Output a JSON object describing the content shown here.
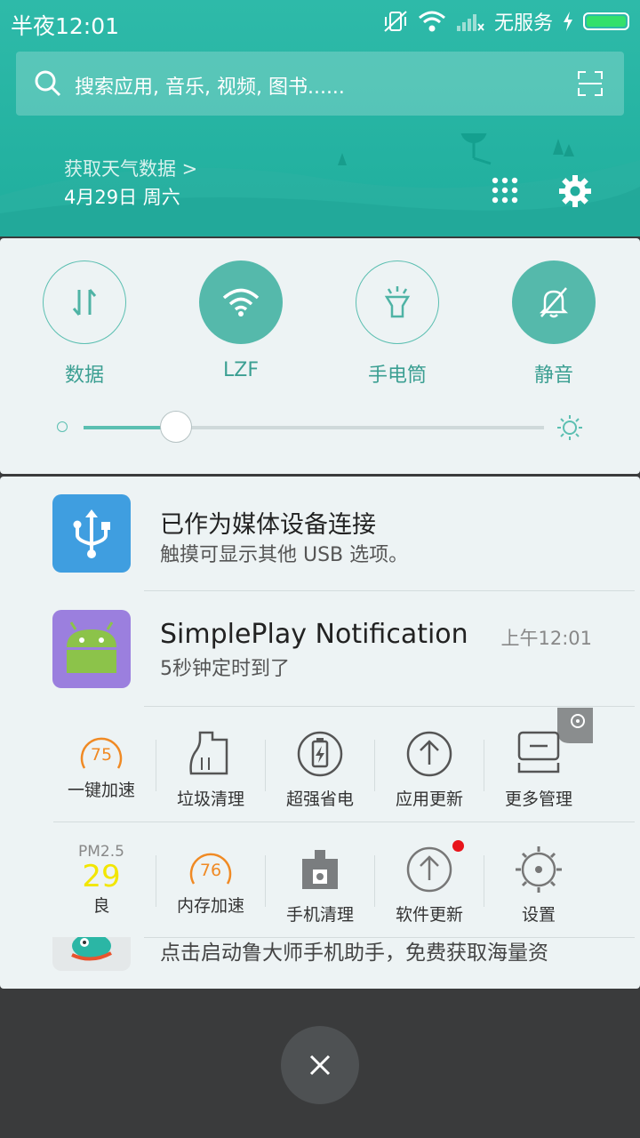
{
  "status_bar": {
    "time": "半夜12:01",
    "carrier": "无服务"
  },
  "search": {
    "placeholder": "搜索应用, 音乐, 视频, 图书......"
  },
  "weather": {
    "link": "获取天气数据 >",
    "date": "4月29日 周六"
  },
  "quick_settings": {
    "toggles": [
      {
        "label": "数据",
        "icon": "data-arrows-icon",
        "active": false
      },
      {
        "label": "LZF",
        "icon": "wifi-icon",
        "active": true
      },
      {
        "label": "手电筒",
        "icon": "flashlight-icon",
        "active": false
      },
      {
        "label": "静音",
        "icon": "bell-mute-icon",
        "active": true
      }
    ],
    "brightness": 0.2
  },
  "notifications": [
    {
      "title": "已作为媒体设备连接",
      "text": "触摸可显示其他 USB 选项。",
      "icon": "usb-icon",
      "color": "#3f9ee0"
    },
    {
      "title": "SimplePlay Notification",
      "text": "5秒钟定时到了",
      "time": "上午12:01",
      "icon": "android-icon",
      "color": "#9b7fde"
    }
  ],
  "toolbox": {
    "row1": [
      {
        "label": "一键加速",
        "value": "75"
      },
      {
        "label": "垃圾清理"
      },
      {
        "label": "超强省电"
      },
      {
        "label": "应用更新"
      },
      {
        "label": "更多管理"
      }
    ],
    "row2": [
      {
        "label": "良",
        "pm_label": "PM2.5",
        "pm_value": "29"
      },
      {
        "label": "内存加速",
        "value": "76"
      },
      {
        "label": "手机清理"
      },
      {
        "label": "软件更新"
      },
      {
        "label": "设置"
      }
    ]
  },
  "bottom_text": "点击启动鲁大师手机助手，免费获取海量资",
  "colors": {
    "accent": "#2ebaa9",
    "gauge": "#f08a24",
    "pm_value": "#f2e600",
    "badge": "#e8141b"
  }
}
